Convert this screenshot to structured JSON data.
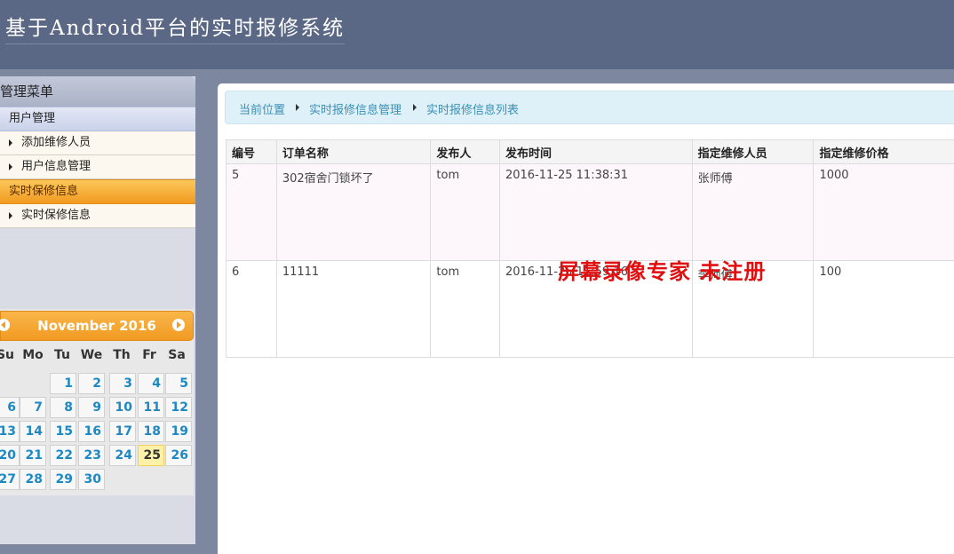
{
  "header": {
    "title": "基于Android平台的实时报修系统"
  },
  "sidebar": {
    "menu_title": "管理菜单",
    "groups": [
      {
        "label": "用户管理",
        "items": [
          {
            "label": "添加维修人员"
          },
          {
            "label": "用户信息管理"
          }
        ]
      },
      {
        "label": "实时保修信息",
        "items": [
          {
            "label": "实时保修信息"
          }
        ]
      }
    ]
  },
  "calendar": {
    "month_label": "November 2016",
    "weekdays": [
      "Su",
      "Mo",
      "Tu",
      "We",
      "Th",
      "Fr",
      "Sa"
    ],
    "today": "25"
  },
  "breadcrumb": [
    "当前位置",
    "实时报修信息管理",
    "实时报修信息列表"
  ],
  "table": {
    "headers": [
      "编号",
      "订单名称",
      "发布人",
      "发布时间",
      "指定维修人员",
      "指定维修价格"
    ],
    "rows": [
      [
        "5",
        "302宿舍门锁坏了",
        "tom",
        "2016-11-25 11:38:31",
        "张师傅",
        "1000"
      ],
      [
        "6",
        "11111",
        "tom",
        "2016-11-25 11:59:16",
        "李师傅",
        "100"
      ]
    ]
  },
  "watermark": "屏幕录像专家 未注册"
}
